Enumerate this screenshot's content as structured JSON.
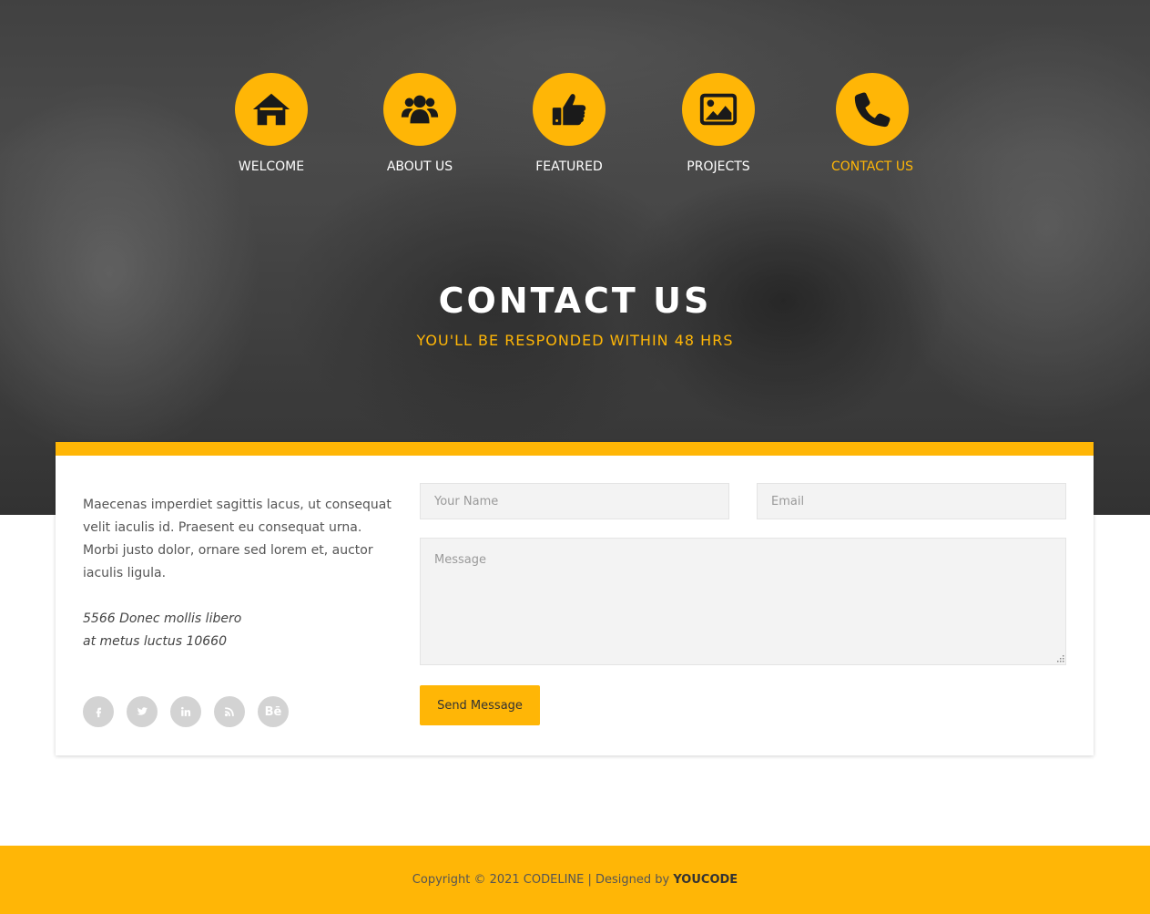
{
  "accent_color": "#ffb606",
  "nav": {
    "items": [
      {
        "label": "WELCOME",
        "icon": "home-icon",
        "active": false
      },
      {
        "label": "ABOUT US",
        "icon": "users-icon",
        "active": false
      },
      {
        "label": "FEATURED",
        "icon": "thumbs-up-icon",
        "active": false
      },
      {
        "label": "PROJECTS",
        "icon": "image-icon",
        "active": false
      },
      {
        "label": "CONTACT US",
        "icon": "phone-icon",
        "active": true
      }
    ]
  },
  "hero": {
    "title": "CONTACT US",
    "subtitle": "YOU'LL BE RESPONDED WITHIN 48 HRS"
  },
  "contact": {
    "description": "Maecenas imperdiet sagittis lacus, ut consequat velit iaculis id. Praesent eu consequat urna. Morbi justo dolor, ornare sed lorem et, auctor iaculis ligula.",
    "address_line1": "5566 Donec mollis libero",
    "address_line2": "at metus luctus 10660",
    "social": [
      {
        "name": "facebook-icon"
      },
      {
        "name": "twitter-icon"
      },
      {
        "name": "linkedin-icon"
      },
      {
        "name": "rss-icon"
      },
      {
        "name": "behance-icon",
        "text": "Bē"
      }
    ]
  },
  "form": {
    "name_placeholder": "Your Name",
    "email_placeholder": "Email",
    "message_placeholder": "Message",
    "submit_label": "Send Message"
  },
  "footer": {
    "copyright": "Copyright © 2021 CODELINE | Designed by",
    "designer": "YOUCODE"
  }
}
